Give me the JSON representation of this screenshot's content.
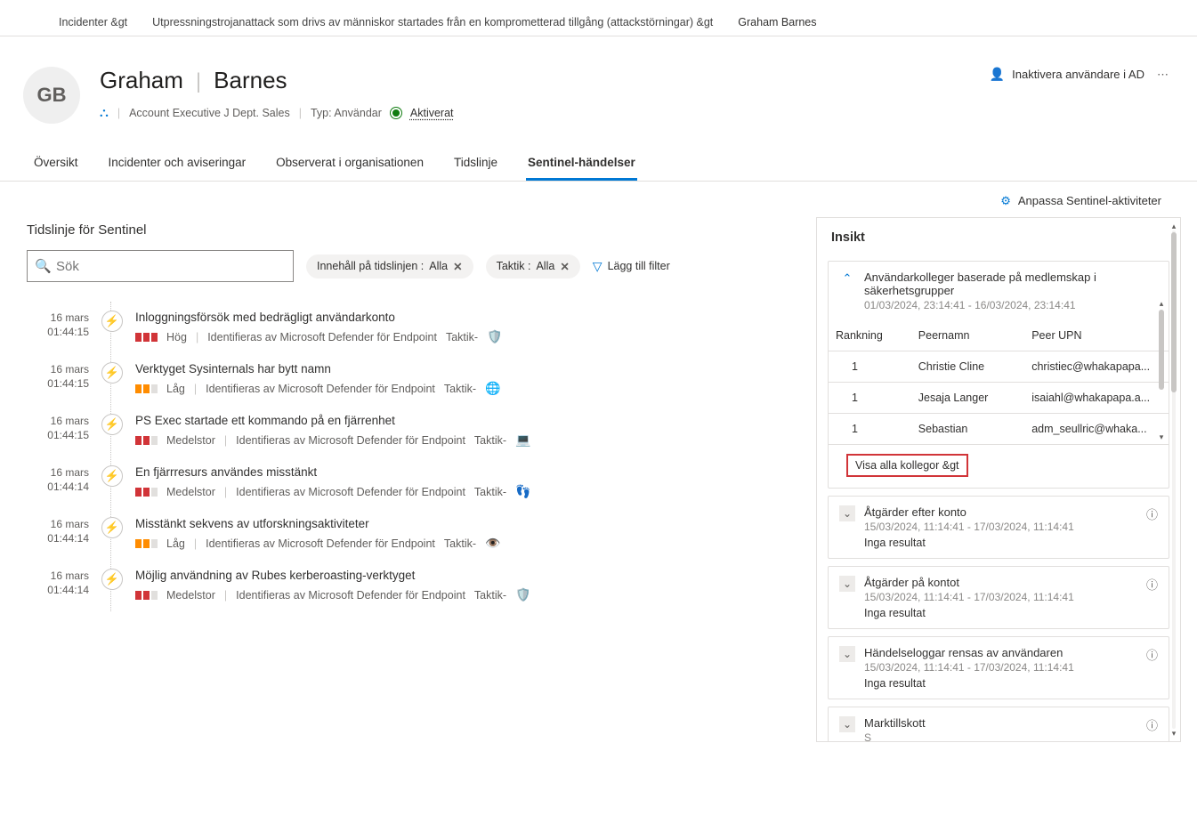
{
  "breadcrumbs": {
    "item0": "Incidenter &gt",
    "item1": "Utpressningstrojanattack som drivs av människor startades från en komprometterad tillgång (attackstörningar) &gt",
    "item2": "Graham Barnes"
  },
  "header": {
    "initials": "GB",
    "first_name": "Graham",
    "last_name": "Barnes",
    "role": "Account Executive J Dept. Sales",
    "type_label": "Typ: Användar",
    "status_label": "Aktiverat",
    "action_disable": "Inaktivera användare i AD"
  },
  "tabs": {
    "t0": "Översikt",
    "t1": "Incidenter och aviseringar",
    "t2": "Observerat i organisationen",
    "t3": "Tidslinje",
    "t4": "Sentinel-händelser"
  },
  "toolbar": {
    "customize": "Anpassa Sentinel-aktiviteter"
  },
  "timeline": {
    "title": "Tidslinje för Sentinel",
    "search_placeholder": "Sök",
    "pill_content_label": "Innehåll på tidslinjen :",
    "pill_content_value": "Alla",
    "pill_tactic_label": "Taktik  :",
    "pill_tactic_value": "Alla",
    "add_filter": "Lägg till filter",
    "items": [
      {
        "date": "16 mars",
        "time": "01:44:15",
        "title": "Inloggningsförsök med bedrägligt användarkonto",
        "severity": "high",
        "severity_label": "Hög",
        "source": "Identifieras av Microsoft Defender för Endpoint",
        "tactic": "Taktik-",
        "glyph": "🛡️"
      },
      {
        "date": "16 mars",
        "time": "01:44:15",
        "title": "Verktyget Sysinternals har bytt namn",
        "severity": "low",
        "severity_label": "Låg",
        "source": "Identifieras av Microsoft Defender för Endpoint",
        "tactic": "Taktik-",
        "glyph": "🌐"
      },
      {
        "date": "16 mars",
        "time": "01:44:15",
        "title": "PS Exec startade ett kommando på en fjärrenhet",
        "severity": "med",
        "severity_label": "Medelstor",
        "source": "Identifieras av Microsoft Defender för Endpoint",
        "tactic": "Taktik-",
        "glyph": "💻"
      },
      {
        "date": "16 mars",
        "time": "01:44:14",
        "title": "En fjärrresurs användes misstänkt",
        "severity": "med",
        "severity_label": "Medelstor",
        "source": "Identifieras av Microsoft Defender för Endpoint",
        "tactic": "Taktik-",
        "glyph": "👣"
      },
      {
        "date": "16 mars",
        "time": "01:44:14",
        "title": "Misstänkt sekvens av utforskningsaktiviteter",
        "severity": "low",
        "severity_label": "Låg",
        "source": "Identifieras av Microsoft Defender för Endpoint",
        "tactic": "Taktik-",
        "glyph": "👁️"
      },
      {
        "date": "16 mars",
        "time": "01:44:14",
        "title": "Möjlig användning av Rubes kerberoasting-verktyget",
        "severity": "med",
        "severity_label": "Medelstor",
        "source": "Identifieras av Microsoft Defender för Endpoint",
        "tactic": "Taktik-",
        "glyph": "🛡️"
      }
    ]
  },
  "insight": {
    "title": "Insikt",
    "peers_card": {
      "title": "Användarkolleger baserade på medlemskap i säkerhetsgrupper",
      "range": "01/03/2024, 23:14:41 - 16/03/2024, 23:14:41",
      "col_rank": "Rankning",
      "col_name": "Peernamn",
      "col_upn": "Peer UPN",
      "rows": [
        {
          "rank": "1",
          "name": "Christie Cline",
          "upn": "christiec@whakapapa..."
        },
        {
          "rank": "1",
          "name": "Jesaja Langer",
          "upn": "isaiahl@whakapapa.a..."
        },
        {
          "rank": "1",
          "name": "Sebastian",
          "upn": "adm_seullric@whaka..."
        }
      ],
      "show_all": "Visa alla kollegor &gt"
    },
    "closed_cards": [
      {
        "title": "Åtgärder efter konto",
        "range": "15/03/2024, 11:14:41 - 17/03/2024, 11:14:41",
        "result": "Inga resultat"
      },
      {
        "title": "Åtgärder på kontot",
        "range": "15/03/2024, 11:14:41 - 17/03/2024, 11:14:41",
        "result": "Inga resultat"
      },
      {
        "title": "Händelseloggar rensas av användaren",
        "range": "15/03/2024, 11:14:41 - 17/03/2024, 11:14:41",
        "result": "Inga resultat"
      },
      {
        "title": "Marktillskott",
        "range": "S",
        "result": ""
      }
    ]
  }
}
